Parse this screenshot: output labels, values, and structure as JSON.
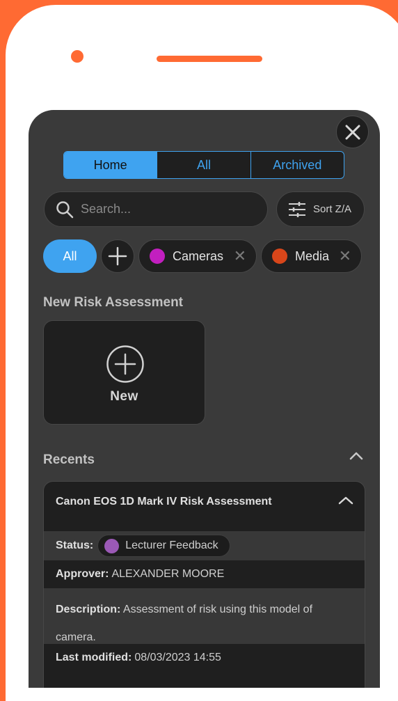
{
  "colors": {
    "accent": "#3fa3f0",
    "brand": "#ff6a33",
    "cameras": "#c21fbf",
    "media": "#d8461a",
    "status": "#9b59b6"
  },
  "icons": [
    "close-icon",
    "search-icon",
    "sliders-icon",
    "plus-icon",
    "circle-plus-icon",
    "chevron-up-icon"
  ],
  "tabs": [
    {
      "label": "Home",
      "active": true
    },
    {
      "label": "All",
      "active": false
    },
    {
      "label": "Archived",
      "active": false
    }
  ],
  "search": {
    "placeholder": "Search..."
  },
  "sort": {
    "label": "Sort Z/A"
  },
  "filters": {
    "all_label": "All",
    "chips": [
      {
        "label": "Cameras",
        "color": "#c21fbf"
      },
      {
        "label": "Media",
        "color": "#d8461a"
      }
    ]
  },
  "new_section": {
    "title": "New Risk Assessment",
    "new_label": "New"
  },
  "recents": {
    "title": "Recents",
    "items": [
      {
        "title": "Canon EOS 1D Mark IV Risk Assessment",
        "status_label": "Status:",
        "status_value": "Lecturer Feedback",
        "approver_label": "Approver:",
        "approver_value": "ALEXANDER MOORE",
        "description_label": "Description:",
        "description_value": "Assessment of risk using this model of camera.",
        "modified_label": "Last modified:",
        "modified_value": "08/03/2023 14:55"
      }
    ]
  }
}
